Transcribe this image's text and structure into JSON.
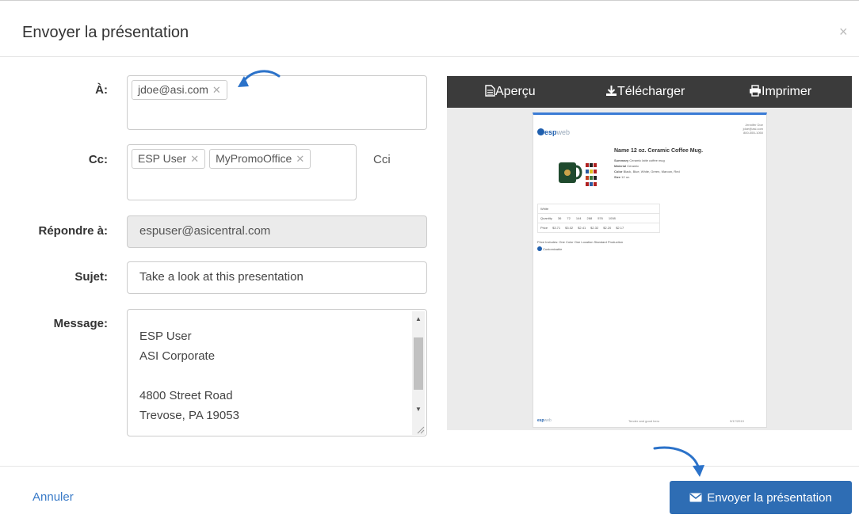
{
  "dialog": {
    "title": "Envoyer la présentation",
    "close_glyph": "×"
  },
  "form": {
    "to_label": "À:",
    "to_tags": [
      "jdoe@asi.com"
    ],
    "cc_label": "Cc:",
    "cc_tags": [
      "ESP User",
      "MyPromoOffice"
    ],
    "bcc_link": "Cci",
    "reply_label": "Répondre à:",
    "reply_value": "espuser@asicentral.com",
    "subject_label": "Sujet:",
    "subject_value": "Take a look at this presentation",
    "message_label": "Message:",
    "message_lines": [
      "ESP User",
      "ASI Corporate",
      "",
      "4800 Street Road",
      "Trevose, PA 19053"
    ]
  },
  "preview": {
    "preview_label": "Aperçu",
    "download_label": "Télécharger",
    "print_label": "Imprimer",
    "doc": {
      "brand_a": "esp",
      "brand_b": "web",
      "contact": [
        "Jennifer Doe",
        "jdoe@asi.com",
        "800-555-1050"
      ],
      "product_title": "Name 12 oz. Ceramic Coffee Mug.",
      "details": [
        {
          "k": "Summary",
          "v": "Ceramic latte coffee mug"
        },
        {
          "k": "Material",
          "v": "Ceramic"
        },
        {
          "k": "Color",
          "v": "Black, Blue, White, Green, Maroon, Red"
        },
        {
          "k": "Size",
          "v": "12 oz."
        }
      ],
      "table_header": "White",
      "qty_label": "Quantity",
      "quantities": [
        "36",
        "72",
        "144",
        "288",
        "576",
        "1008"
      ],
      "price_label": "Price",
      "prices": [
        "$3.71",
        "$3.02",
        "$2.41",
        "$2.32",
        "$2.20",
        "$2.17"
      ],
      "includes": "Price Includes: One Color One Location Standard Production",
      "note": "Customizable",
      "footer_mid": "Tender and good hero",
      "footer_right": "9/17/2019"
    }
  },
  "footer": {
    "cancel_label": "Annuler",
    "send_label": "Envoyer la présentation"
  },
  "colors": {
    "primary": "#2e6db4",
    "link": "#3a7bc8",
    "toolbar": "#3b3b3b",
    "annotation_arrow": "#2b72c9"
  }
}
